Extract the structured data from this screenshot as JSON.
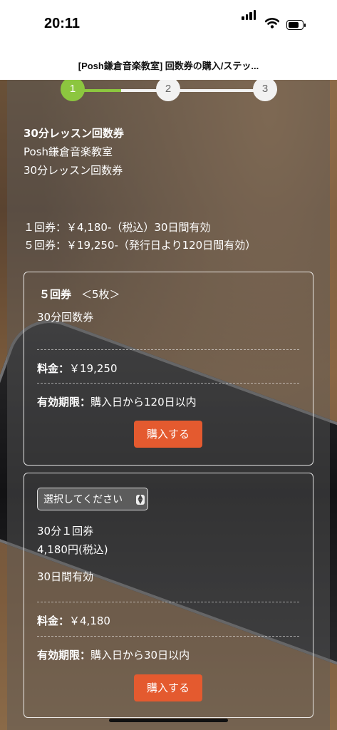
{
  "status_bar": {
    "time": "20:11"
  },
  "page_title": "[Posh鎌倉音楽教室] 回数券の購入/ステッ...",
  "steps": [
    "1",
    "2",
    "3"
  ],
  "intro": {
    "heading": "30分レッスン回数券",
    "line1": "Posh鎌倉音楽教室",
    "line2": "30分レッスン回数券",
    "price_line1": "１回券：￥4,180-（税込）30日間有効",
    "price_line2": "５回券：￥19,250-（発行日より120日間有効）"
  },
  "card1": {
    "title": "５回券",
    "subtitle": "＜5枚＞",
    "desc": "30分回数券",
    "price_label": "料金：",
    "price_value": "￥19,250",
    "validity_label": "有効期限：",
    "validity_value": "購入日から120日以内",
    "button": "購入する"
  },
  "card2": {
    "select_placeholder": "選択してください",
    "desc1": "30分１回券",
    "desc2": "4,180円(税込)",
    "desc3": "30日間有効",
    "price_label": "料金：",
    "price_value": "￥4,180",
    "validity_label": "有効期限：",
    "validity_value": "購入日から30日以内",
    "button": "購入する"
  },
  "colors": {
    "accent_green": "#8cc63f",
    "button_orange": "#e45a2f"
  }
}
